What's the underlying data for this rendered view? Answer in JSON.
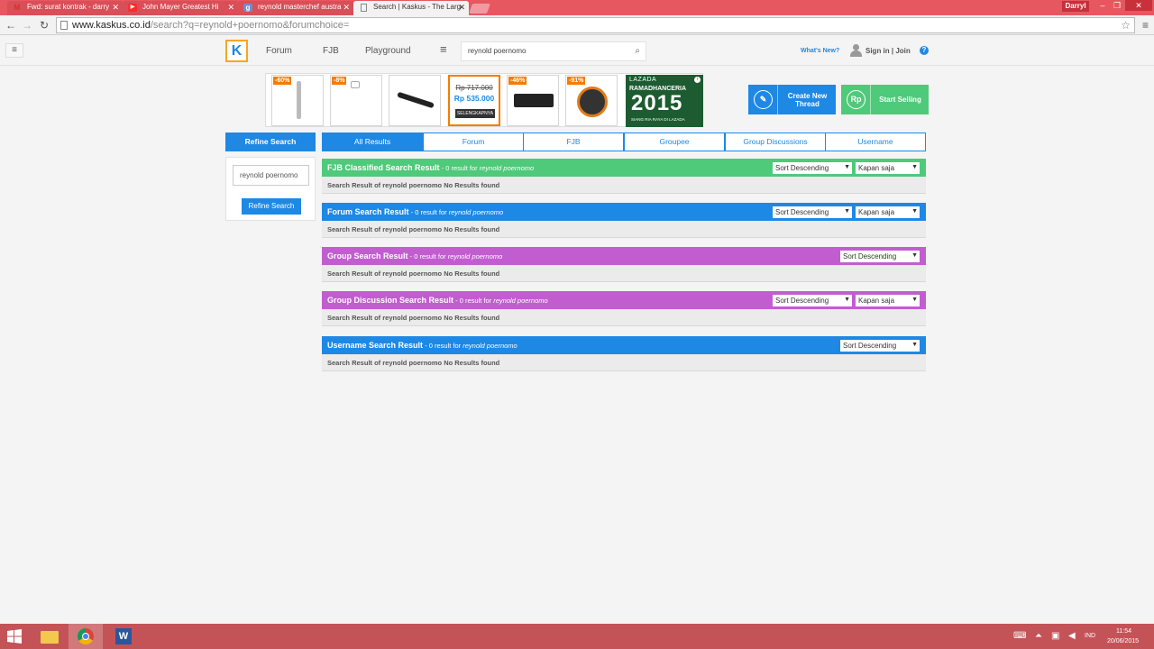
{
  "browser": {
    "tabs": [
      {
        "title": "Fwd: surat kontrak - darry",
        "icon": "gmail-icon"
      },
      {
        "title": "John Mayer Greatest Hi",
        "icon": "youtube-icon"
      },
      {
        "title": "reynold masterchef austra",
        "icon": "google-search-icon"
      },
      {
        "title": "Search | Kaskus - The Larg",
        "icon": "page-icon"
      }
    ],
    "user": "Darryl",
    "url_host": "www.kaskus.co.id",
    "url_path": "/search?q=reynold+poernomo&forumchoice="
  },
  "header": {
    "logo": "K",
    "nav": [
      "Forum",
      "FJB",
      "Playground"
    ],
    "search_value": "reynold poernomo",
    "whats_new": "What's New?",
    "signin": "Sign in | Join",
    "help": "?"
  },
  "ad": {
    "items": [
      {
        "discount": "-60%"
      },
      {
        "discount": "-8%"
      },
      {
        "discount": ""
      },
      {
        "old_price": "Rp 717.000",
        "new_price": "Rp 535.000",
        "button": "SELENGKAPNYA"
      },
      {
        "discount": "-46%"
      },
      {
        "discount": "-91%"
      }
    ],
    "lazada": {
      "brand": "LAZADA",
      "campaign": "RAMADHANCERIA",
      "year": "2015",
      "tagline": "SIANG RIA RAYA DI LAZADA"
    }
  },
  "actions": {
    "create_thread": "Create New Thread",
    "create_icon": "pencil-icon",
    "start_selling": "Start Selling",
    "sell_icon": "Rp"
  },
  "sidebar": {
    "title": "Refine Search",
    "input_value": "reynold poernomo",
    "button": "Refine Search"
  },
  "search_tabs": [
    "All Results",
    "Forum",
    "FJB",
    "Groupee",
    "Group Discussions",
    "Username"
  ],
  "results": [
    {
      "title": "FJB Classified Search Result",
      "count": " - 0 result for ",
      "query": "reynold poernomo",
      "sort": "Sort Descending",
      "time": "Kapan saja",
      "message": "Search Result of reynold poernomo No Results found",
      "color": "#4fc97a"
    },
    {
      "title": "Forum Search Result",
      "count": " - 0 result for ",
      "query": "reynold poernomo",
      "sort": "Sort Descending",
      "time": "Kapan saja",
      "message": "Search Result of reynold poernomo No Results found",
      "color": "#1e88e5"
    },
    {
      "title": "Group Search Result",
      "count": " - 0 result for ",
      "query": "reynold poernomo",
      "sort": "Sort Descending",
      "time": "",
      "message": "Search Result of reynold poernomo No Results found",
      "color": "#c25dd0"
    },
    {
      "title": "Group Discussion Search Result",
      "count": " - 0 result for ",
      "query": "reynold poernomo",
      "sort": "Sort Descending",
      "time": "Kapan saja",
      "message": "Search Result of reynold poernomo No Results found",
      "color": "#c25dd0"
    },
    {
      "title": "Username Search Result",
      "count": " - 0 result for ",
      "query": "reynold poernomo",
      "sort": "Sort Descending",
      "time": "",
      "message": "Search Result of reynold poernomo No Results found",
      "color": "#1e88e5"
    }
  ],
  "taskbar": {
    "lang": "IND",
    "time": "11:54",
    "date": "20/06/2015"
  },
  "colors": {
    "accent": "#1e88e5",
    "green": "#4fc97a",
    "purple": "#c25dd0",
    "titlebar": "#e6575f",
    "taskbar": "#c45357"
  }
}
